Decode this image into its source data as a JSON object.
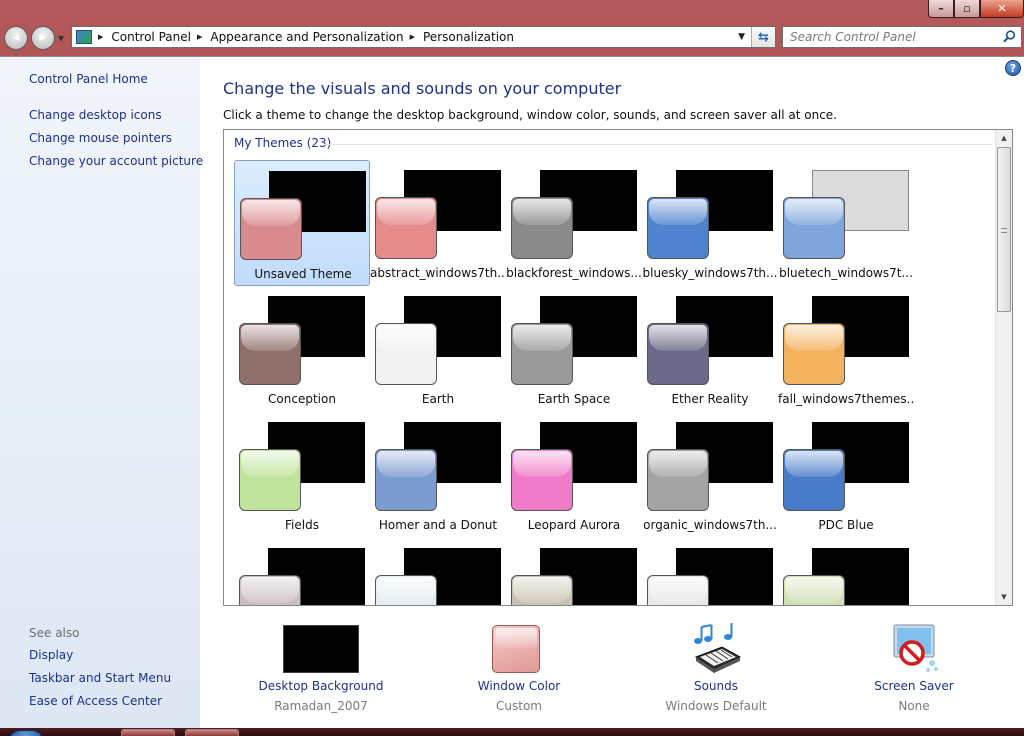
{
  "window": {
    "controls": {
      "minimize": "–",
      "maximize": "▫",
      "close": "✕"
    }
  },
  "nav": {
    "back_glyph": "◀",
    "forward_glyph": "▶",
    "breadcrumbs": [
      "Control Panel",
      "Appearance and Personalization",
      "Personalization"
    ],
    "search_placeholder": "Search Control Panel"
  },
  "sidebar": {
    "home": "Control Panel Home",
    "links": [
      "Change desktop icons",
      "Change mouse pointers",
      "Change your account picture"
    ],
    "see_also_title": "See also",
    "see_also": [
      "Display",
      "Taskbar and Start Menu",
      "Ease of Access Center"
    ]
  },
  "main": {
    "title": "Change the visuals and sounds on your computer",
    "subtitle": "Click a theme to change the desktop background, window color, sounds, and screen saver all at once.",
    "group_title": "My Themes (23)",
    "help_glyph": "?",
    "themes": [
      {
        "name": "Unsaved Theme",
        "color": "#d98a8e",
        "selected": true
      },
      {
        "name": "abstract_windows7th...",
        "color": "#e58b8b"
      },
      {
        "name": "blackforest_windows...",
        "color": "#8a8a8a"
      },
      {
        "name": "bluesky_windows7th...",
        "color": "#4f82cf"
      },
      {
        "name": "bluetech_windows7t...",
        "color": "#7fa6dc",
        "light_bg": true
      },
      {
        "name": "Conception",
        "color": "#8e6f6c"
      },
      {
        "name": "Earth",
        "color": "#f2f2f2"
      },
      {
        "name": "Earth Space",
        "color": "#9a9a9a"
      },
      {
        "name": "Ether Reality",
        "color": "#6c6a8a"
      },
      {
        "name": "fall_windows7themes...",
        "color": "#f2b25e"
      },
      {
        "name": "Fields",
        "color": "#bfe39a"
      },
      {
        "name": "Homer and a Donut",
        "color": "#7c9bd0"
      },
      {
        "name": "Leopard Aurora",
        "color": "#ee7cc8"
      },
      {
        "name": "organic_windows7th...",
        "color": "#a4a4a4"
      },
      {
        "name": "PDC Blue",
        "color": "#4a7bc8"
      },
      {
        "name": "",
        "color": "#cbbec0"
      },
      {
        "name": "",
        "color": "#e3edf5"
      },
      {
        "name": "",
        "color": "#c9c2b2"
      },
      {
        "name": "",
        "color": "#e8e8e8"
      },
      {
        "name": "",
        "color": "#cfe0b4"
      }
    ]
  },
  "bottom": {
    "desktop_background": {
      "label": "Desktop Background",
      "value": "Ramadan_2007"
    },
    "window_color": {
      "label": "Window Color",
      "value": "Custom"
    },
    "sounds": {
      "label": "Sounds",
      "value": "Windows Default"
    },
    "screen_saver": {
      "label": "Screen Saver",
      "value": "None"
    }
  }
}
